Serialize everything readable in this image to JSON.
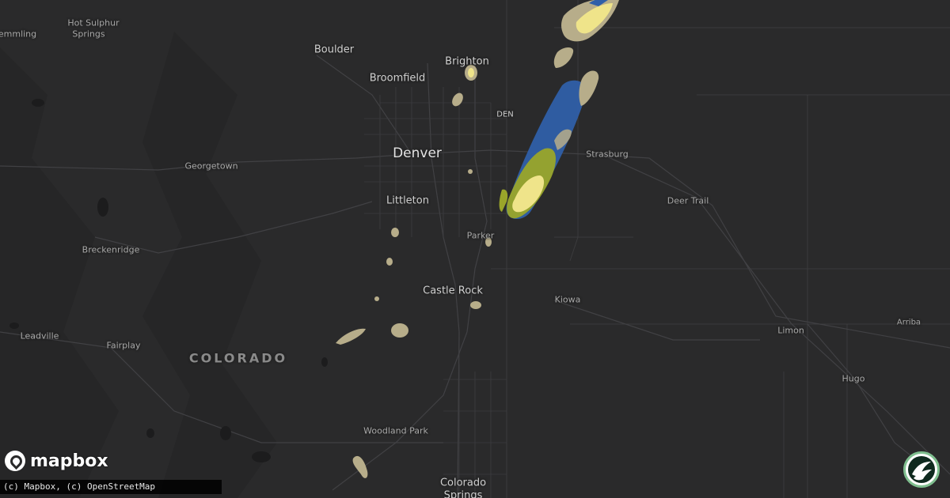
{
  "map": {
    "state_label": "COLORADO",
    "airport_label": "DEN",
    "cities": {
      "denver": "Denver",
      "boulder": "Boulder",
      "broomfield": "Broomfield",
      "brighton": "Brighton",
      "littleton": "Littleton",
      "parker": "Parker",
      "castle_rock": "Castle Rock",
      "strasburg": "Strasburg",
      "deer_trail": "Deer Trail",
      "kiowa": "Kiowa",
      "limon": "Limon",
      "arriba": "Arriba",
      "hugo": "Hugo",
      "georgetown": "Georgetown",
      "breckenridge": "Breckenridge",
      "leadville": "Leadville",
      "fairplay": "Fairplay",
      "woodland_park": "Woodland Park",
      "colorado_springs_line1": "Colorado",
      "colorado_springs_line2": "Springs",
      "hot_sulphur_line1": "Hot Sulphur",
      "hot_sulphur_line2": "Springs",
      "kremmling_partial": "emmling"
    },
    "colors": {
      "background": "#2a2a2b",
      "roads": "#3a3a3c",
      "hail_blue": "#2f5fa8",
      "hail_olive": "#9aa52a",
      "hail_yellow": "#efe48a",
      "hail_tan": "#b7ad8a"
    }
  },
  "branding": {
    "logo_text": "mapbox",
    "attribution": "(c) Mapbox, (c) OpenStreetMap"
  }
}
